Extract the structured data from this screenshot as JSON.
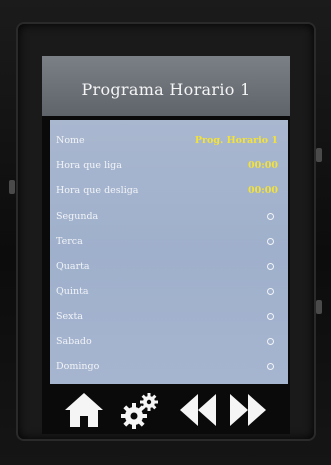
{
  "screen": {
    "title": "Programa Horario 1"
  },
  "settings": {
    "name": {
      "label": "Nome",
      "value": "Prog. Horario 1"
    },
    "on_time": {
      "label": "Hora que liga",
      "value": "00:00"
    },
    "off_time": {
      "label": "Hora que desliga",
      "value": "00:00"
    }
  },
  "days": [
    {
      "label": "Segunda"
    },
    {
      "label": "Terca"
    },
    {
      "label": "Quarta"
    },
    {
      "label": "Quinta"
    },
    {
      "label": "Sexta"
    },
    {
      "label": "Sabado"
    },
    {
      "label": "Domingo"
    }
  ],
  "toolbar": {
    "home_icon": "home-icon",
    "settings_icon": "gears-icon",
    "previous_icon": "double-left-arrow-icon",
    "next_icon": "double-right-arrow-icon"
  },
  "colors": {
    "list_background": "#a6b5cf",
    "value_text": "#f3e23a",
    "title_bar": "#6b7177"
  }
}
